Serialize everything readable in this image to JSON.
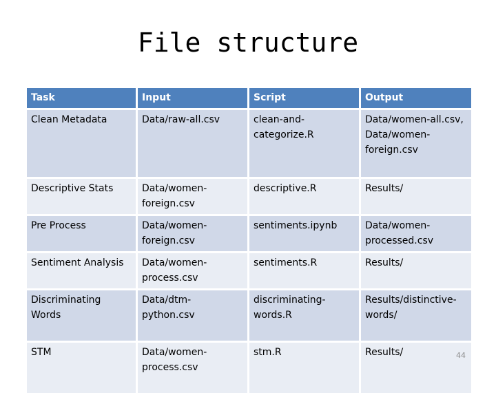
{
  "title": "File structure",
  "table": {
    "headers": [
      "Task",
      "Input",
      "Script",
      "Output"
    ],
    "rows": [
      [
        "Clean Metadata",
        "Data/raw-all.csv",
        "clean-and-categorize.R",
        "Data/women-all.csv, Data/women-foreign.csv"
      ],
      [
        "Descriptive Stats",
        "Data/women-foreign.csv",
        "descriptive.R",
        "Results/"
      ],
      [
        "Pre Process",
        "Data/women-foreign.csv",
        "sentiments.ipynb",
        "Data/women-processed.csv"
      ],
      [
        "Sentiment Analysis",
        "Data/women-process.csv",
        "sentiments.R",
        "Results/"
      ],
      [
        "Discriminating Words",
        "Data/dtm-python.csv",
        "discriminating-words.R",
        "Results/distinctive-words/"
      ],
      [
        "STM",
        "Data/women-process.csv",
        "stm.R",
        "Results/"
      ]
    ]
  },
  "colors": {
    "header_bg": "#4f81bd",
    "row_odd_bg": "#d0d8e8",
    "row_even_bg": "#e9edf4"
  },
  "page_number": "44"
}
